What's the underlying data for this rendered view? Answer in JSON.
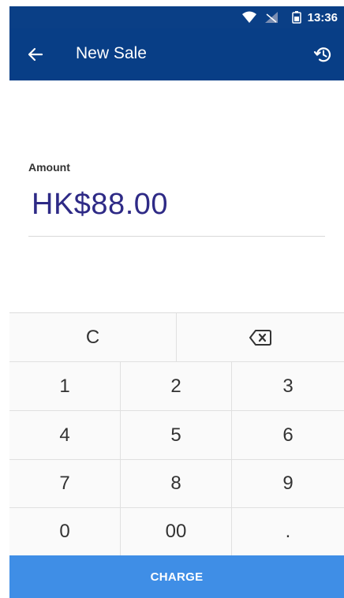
{
  "status_bar": {
    "time": "13:36",
    "wifi_icon": "wifi-icon",
    "signal_icon": "no-signal-icon",
    "battery_icon": "battery-icon"
  },
  "app_bar": {
    "title": "New Sale",
    "back_icon": "arrow-back-icon",
    "history_icon": "history-icon"
  },
  "amount": {
    "label": "Amount",
    "value": "HK$88.00"
  },
  "keypad": {
    "clear": "C",
    "backspace_icon": "backspace-icon",
    "keys": [
      "1",
      "2",
      "3",
      "4",
      "5",
      "6",
      "7",
      "8",
      "9",
      "0",
      "00",
      "."
    ]
  },
  "charge_label": "CHARGE",
  "colors": {
    "app_bar": "#083e86",
    "amount_text": "#2e2a86",
    "charge_button": "#3f8ee6"
  }
}
